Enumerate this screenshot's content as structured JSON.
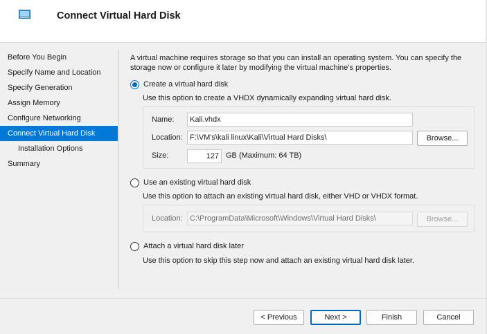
{
  "header": {
    "title": "Connect Virtual Hard Disk"
  },
  "nav": {
    "items": [
      {
        "label": "Before You Begin"
      },
      {
        "label": "Specify Name and Location"
      },
      {
        "label": "Specify Generation"
      },
      {
        "label": "Assign Memory"
      },
      {
        "label": "Configure Networking"
      },
      {
        "label": "Connect Virtual Hard Disk"
      },
      {
        "label": "Installation Options"
      },
      {
        "label": "Summary"
      }
    ],
    "active_index": 5
  },
  "intro": "A virtual machine requires storage so that you can install an operating system. You can specify the storage now or configure it later by modifying the virtual machine’s properties.",
  "create": {
    "label": "Create a virtual hard disk",
    "description": "Use this option to create a VHDX dynamically expanding virtual hard disk.",
    "checked": true,
    "name_label": "Name:",
    "name_value": "Kali.vhdx",
    "location_label": "Location:",
    "location_value": "F:\\VM's\\kali linux\\Kali\\Virtual Hard Disks\\",
    "browse_label": "Browse...",
    "size_label": "Size:",
    "size_value": "127",
    "size_unit": "GB (Maximum: 64 TB)"
  },
  "existing": {
    "label": "Use an existing virtual hard disk",
    "description": "Use this option to attach an existing virtual hard disk, either VHD or VHDX format.",
    "checked": false,
    "location_label": "Location:",
    "location_value": "C:\\ProgramData\\Microsoft\\Windows\\Virtual Hard Disks\\",
    "browse_label": "Browse..."
  },
  "later": {
    "label": "Attach a virtual hard disk later",
    "description": "Use this option to skip this step now and attach an existing virtual hard disk later.",
    "checked": false
  },
  "footer": {
    "previous": "< Previous",
    "next": "Next >",
    "finish": "Finish",
    "cancel": "Cancel"
  },
  "colors": {
    "accent": "#0078d7",
    "radio": "#0067c0"
  }
}
